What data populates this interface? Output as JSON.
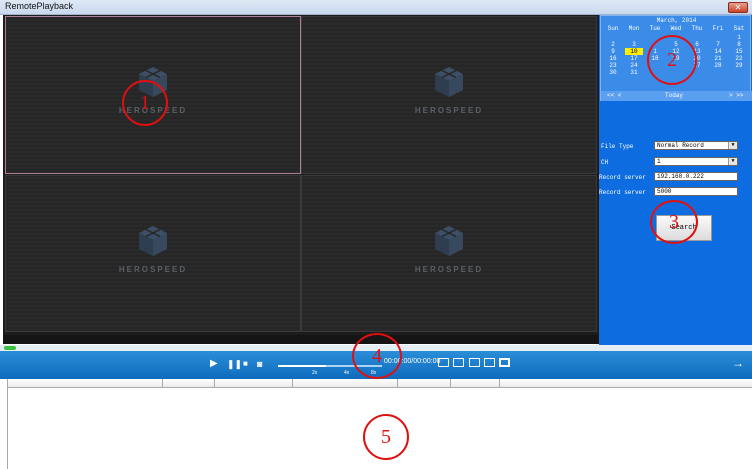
{
  "window": {
    "title": "RemotePlayback",
    "close_icon": "close-icon"
  },
  "video": {
    "brand": "HEROSPEED",
    "panes": [
      {
        "id": 1,
        "selected": true
      },
      {
        "id": 2,
        "selected": false
      },
      {
        "id": 3,
        "selected": false
      },
      {
        "id": 4,
        "selected": false
      }
    ]
  },
  "calendar": {
    "title": "March, 2014",
    "weekdays": [
      "Sun",
      "Mon",
      "Tue",
      "Wed",
      "Thu",
      "Fri",
      "Sat"
    ],
    "weeks": [
      [
        "",
        "",
        "",
        "",
        "",
        "",
        "1"
      ],
      [
        "2",
        "3",
        "",
        "5",
        "6",
        "7",
        "8"
      ],
      [
        "9",
        "10",
        "1",
        "12",
        "13",
        "14",
        "15"
      ],
      [
        "16",
        "17",
        "18",
        "19",
        "20",
        "21",
        "22"
      ],
      [
        "23",
        "24",
        "",
        "",
        "27",
        "28",
        "29"
      ],
      [
        "30",
        "31",
        "",
        "",
        "",
        "",
        ""
      ]
    ],
    "highlighted_day": "10",
    "today_label": "Today",
    "prev_label": "<< <",
    "next_label": "> >>"
  },
  "search_form": {
    "file_type_label": "File Type",
    "file_type_value": "Normal Record",
    "ch_label": "CH",
    "ch_value": "1",
    "record_server_label": "Record server",
    "record_server_value": "192.168.0.222",
    "record_server_port_label": "Record server",
    "record_server_port_value": "5000",
    "search_button": "Search"
  },
  "controls": {
    "play_icon": "play-icon",
    "pause_icon": "pause-icon",
    "stop_icon": "stop-icon",
    "snapshot_icon": "camera-icon",
    "speed_labels": [
      "2x",
      "4x",
      "8x"
    ],
    "time_text": "00:00:00/00:00:00",
    "next_arrow": "→"
  },
  "annotations": [
    "1",
    "2",
    "3",
    "4",
    "5"
  ],
  "colors": {
    "accent": "#0d6de0",
    "control_bar": "#1a7ccb",
    "annotation": "#e01010",
    "highlight": "#ffee00"
  }
}
